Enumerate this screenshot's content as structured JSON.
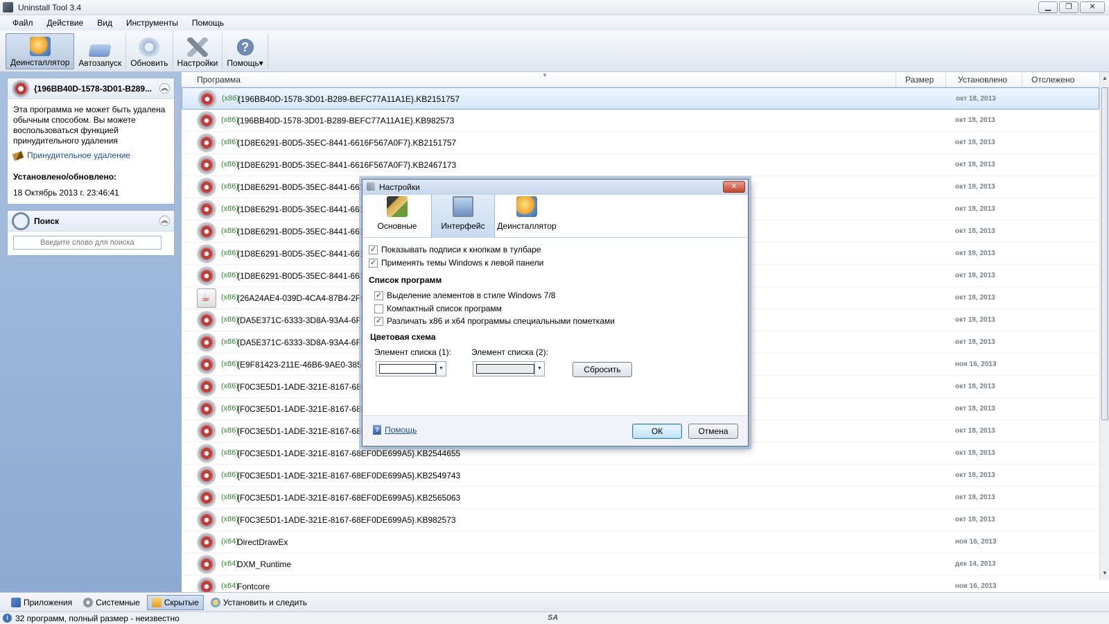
{
  "window": {
    "title": "Uninstall Tool 3.4"
  },
  "menu": [
    "Файл",
    "Действие",
    "Вид",
    "Инструменты",
    "Помощь"
  ],
  "toolbar": {
    "uninstaller": "Деинсталлятор",
    "autorun": "Автозапуск",
    "refresh": "Обновить",
    "settings": "Настройки",
    "help": "Помощь"
  },
  "info_panel": {
    "title": "{196BB40D-1578-3D01-B289...",
    "message": "Эта программа не может быть удалена обычным способом. Вы можете воспользоваться функцией принудительного удаления",
    "force_link": "Принудительное удаление",
    "installed_label": "Установлено/обновлено:",
    "installed_value": "18 Октябрь 2013 г. 23:46:41"
  },
  "search_panel": {
    "title": "Поиск",
    "placeholder": "Введите слово для поиска"
  },
  "columns": {
    "program": "Программа",
    "size": "Размер",
    "installed": "Установлено",
    "tracked": "Отслежено"
  },
  "rows": [
    {
      "arch": "(x86)",
      "name": "{196BB40D-1578-3D01-B289-BEFC77A11A1E}.KB2151757",
      "date": "окт 18, 2013"
    },
    {
      "arch": "(x86)",
      "name": "{196BB40D-1578-3D01-B289-BEFC77A11A1E}.KB982573",
      "date": "окт 18, 2013"
    },
    {
      "arch": "(x86)",
      "name": "{1D8E6291-B0D5-35EC-8441-6616F567A0F7}.KB2151757",
      "date": "окт 18, 2013"
    },
    {
      "arch": "(x86)",
      "name": "{1D8E6291-B0D5-35EC-8441-6616F567A0F7}.KB2467173",
      "date": "окт 18, 2013"
    },
    {
      "arch": "(x86)",
      "name": "{1D8E6291-B0D5-35EC-8441-6616",
      "date": "окт 18, 2013"
    },
    {
      "arch": "(x86)",
      "name": "{1D8E6291-B0D5-35EC-8441-6616",
      "date": "окт 18, 2013"
    },
    {
      "arch": "(x86)",
      "name": "{1D8E6291-B0D5-35EC-8441-6616",
      "date": "окт 18, 2013"
    },
    {
      "arch": "(x86)",
      "name": "{1D8E6291-B0D5-35EC-8441-6616",
      "date": "окт 18, 2013"
    },
    {
      "arch": "(x86)",
      "name": "{1D8E6291-B0D5-35EC-8441-6616",
      "date": "окт 18, 2013"
    },
    {
      "arch": "(x86)",
      "name": "{26A24AE4-039D-4CA4-87B4-2F8",
      "date": "окт 18, 2013",
      "icon": "java"
    },
    {
      "arch": "(x86)",
      "name": "{DA5E371C-6333-3D8A-93A4-6FD",
      "date": "окт 18, 2013"
    },
    {
      "arch": "(x86)",
      "name": "{DA5E371C-6333-3D8A-93A4-6FD",
      "date": "окт 18, 2013"
    },
    {
      "arch": "(x86)",
      "name": "{E9F81423-211E-46B6-9AE0-38568",
      "date": "ноя 16, 2013"
    },
    {
      "arch": "(x86)",
      "name": "{F0C3E5D1-1ADE-321E-8167-68EF",
      "date": "окт 18, 2013"
    },
    {
      "arch": "(x86)",
      "name": "{F0C3E5D1-1ADE-321E-8167-68EF",
      "date": "окт 18, 2013"
    },
    {
      "arch": "(x86)",
      "name": "{F0C3E5D1-1ADE-321E-8167-68EF",
      "date": "окт 18, 2013"
    },
    {
      "arch": "(x86)",
      "name": "{F0C3E5D1-1ADE-321E-8167-68EF0DE699A5}.KB2544655",
      "date": "окт 18, 2013"
    },
    {
      "arch": "(x86)",
      "name": "{F0C3E5D1-1ADE-321E-8167-68EF0DE699A5}.KB2549743",
      "date": "окт 18, 2013"
    },
    {
      "arch": "(x86)",
      "name": "{F0C3E5D1-1ADE-321E-8167-68EF0DE699A5}.KB2565063",
      "date": "окт 18, 2013"
    },
    {
      "arch": "(x86)",
      "name": "{F0C3E5D1-1ADE-321E-8167-68EF0DE699A5}.KB982573",
      "date": "окт 18, 2013"
    },
    {
      "arch": "(x64)",
      "name": "DirectDrawEx",
      "date": "ноя 16, 2013"
    },
    {
      "arch": "(x64)",
      "name": "DXM_Runtime",
      "date": "дек 14, 2013"
    },
    {
      "arch": "(x64)",
      "name": "Fontcore",
      "date": "ноя 16, 2013"
    }
  ],
  "bottom_tabs": {
    "apps": "Приложения",
    "system": "Системные",
    "hidden": "Скрытые",
    "install_track": "Установить и следить"
  },
  "status": {
    "text": "32 программ, полный размер - неизвестно",
    "logo": "SA"
  },
  "dialog": {
    "title": "Настройки",
    "tabs": {
      "basic": "Основные",
      "interface": "Интерфейс",
      "uninstaller": "Деинсталлятор"
    },
    "opt_toolbar_labels": "Показывать подписи к кнопкам в тулбаре",
    "opt_windows_themes": "Применять темы Windows к левой панели",
    "list_section": "Список программ",
    "opt_win7_selection": "Выделение элементов в стиле Windows 7/8",
    "opt_compact_list": "Компактный список программ",
    "opt_arch_marks": "Различать x86 и x64 программы специальными пометками",
    "color_section": "Цветовая схема",
    "item1_label": "Элемент списка (1):",
    "item2_label": "Элемент списка (2):",
    "reset": "Сбросить",
    "help": "Помощь",
    "ok": "ОК",
    "cancel": "Отмена",
    "checked": {
      "toolbar_labels": true,
      "windows_themes": true,
      "win7_selection": true,
      "compact_list": false,
      "arch_marks": true
    }
  }
}
